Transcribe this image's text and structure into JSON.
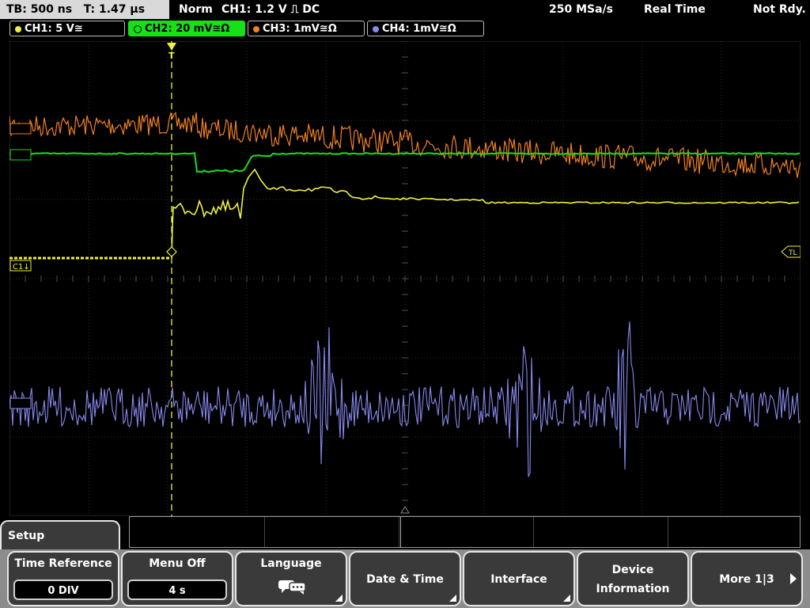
{
  "status": {
    "timebase": "TB: 500 ns",
    "trigger_time": "T: 1.47 µs",
    "mode": "Norm",
    "trigger": "CH1: 1.2 V ⎍ DC",
    "sample_rate": "250 MSa/s",
    "acq_mode": "Real Time",
    "ready": "Not Rdy."
  },
  "channels": [
    {
      "label": "CH1: 5 V≅",
      "color": "#f0f040",
      "active": false
    },
    {
      "label": "CH2: 20 mV≅Ω",
      "color": "#18e018",
      "active": true
    },
    {
      "label": "CH3: 1mV≅Ω",
      "color": "#f08020",
      "active": false
    },
    {
      "label": "CH4: 1mV≅Ω",
      "color": "#8888ee",
      "active": false
    }
  ],
  "markers": {
    "ch1_marker": "C1↓",
    "trigger_level": "TL"
  },
  "colors": {
    "ch1": "#f0f040",
    "ch2": "#18e018",
    "ch3": "#f08020",
    "ch4": "#8888ee",
    "grid": "#3a3a3a"
  },
  "menu": {
    "title": "Setup",
    "softkeys": [
      {
        "label": "Time Reference",
        "value": "0 DIV"
      },
      {
        "label": "Menu Off",
        "value": "4 s"
      },
      {
        "label": "Language",
        "icon": "speech-bubbles-icon"
      },
      {
        "label": "Date & Time"
      },
      {
        "label": "Interface"
      },
      {
        "label_line1": "Device",
        "label_line2": "Information"
      },
      {
        "label": "More 1|3"
      }
    ]
  }
}
